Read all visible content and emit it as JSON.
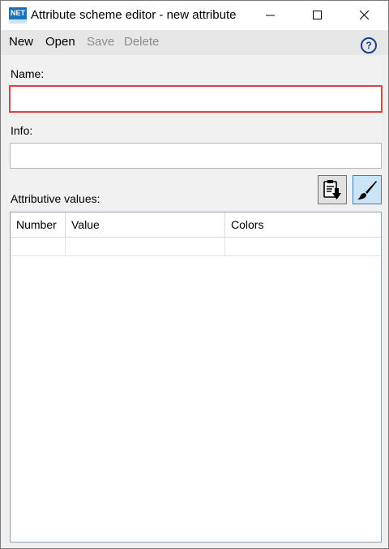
{
  "window": {
    "title": "Attribute scheme editor - new attribute",
    "app_icon_text": "NET",
    "brand_color": "#1a73b8"
  },
  "menu": {
    "new": "New",
    "open": "Open",
    "save": "Save",
    "delete": "Delete",
    "help_symbol": "?"
  },
  "form": {
    "name_label": "Name:",
    "name_value": "",
    "info_label": "Info:",
    "info_value": "",
    "values_label": "Attributive values:"
  },
  "toolbar": {
    "paste_icon": "clipboard-paste-icon",
    "brush_icon": "paint-brush-icon"
  },
  "grid": {
    "columns": [
      "Number",
      "Value",
      "Colors"
    ],
    "rows": [
      {
        "number": "",
        "value": "",
        "colors": ""
      }
    ]
  },
  "colors": {
    "error_border": "#e04040",
    "active_button": "#cce4f7"
  }
}
